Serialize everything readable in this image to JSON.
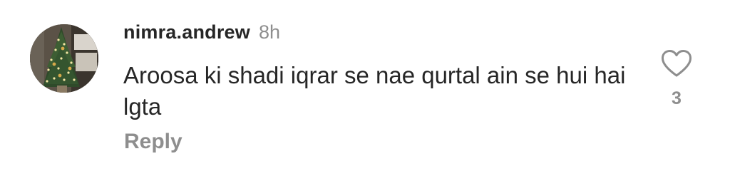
{
  "comment": {
    "username": "nimra.andrew",
    "timestamp": "8h",
    "text": "Aroosa ki shadi iqrar se nae qurtal ain se hui hai lgta",
    "like_count": "3",
    "reply_label": "Reply",
    "avatar_icon": "christmas-tree-photo",
    "like_icon": "heart-outline-icon"
  },
  "colors": {
    "primary_text": "#262626",
    "secondary_text": "#8e8e8e",
    "background": "#ffffff"
  }
}
